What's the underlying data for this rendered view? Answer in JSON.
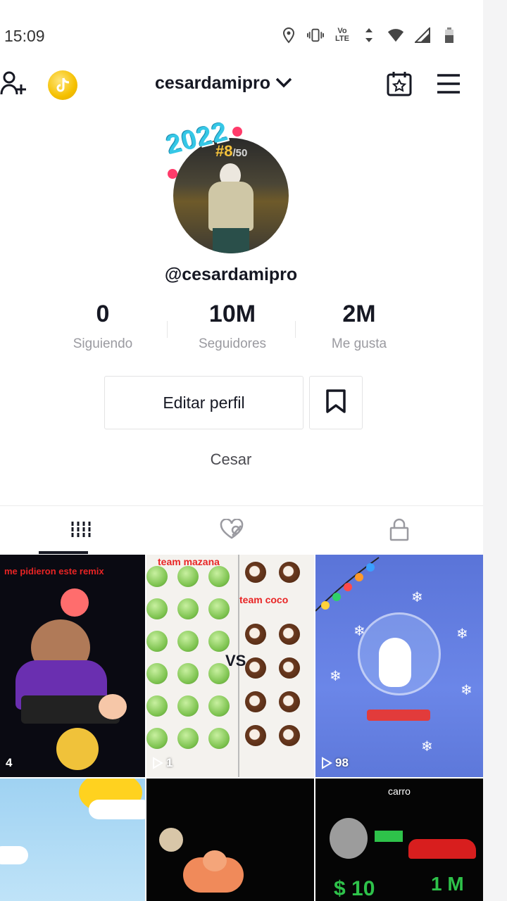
{
  "status_bar": {
    "time": "15:09",
    "network": "LTE"
  },
  "header": {
    "username": "cesardamipro"
  },
  "profile": {
    "handle": "@cesardamipro",
    "avatar_rank": "#8",
    "avatar_rank_total": "/50",
    "avatar_badge": "2022",
    "bio": "Cesar"
  },
  "stats": [
    {
      "value": "0",
      "label": "Siguiendo"
    },
    {
      "value": "10M",
      "label": "Seguidores"
    },
    {
      "value": "2M",
      "label": "Me gusta"
    }
  ],
  "actions": {
    "edit_profile": "Editar perfil"
  },
  "tabs": [
    {
      "name": "videos",
      "icon": "grid-icon",
      "active": true
    },
    {
      "name": "liked",
      "icon": "hidden-heart-icon",
      "active": false
    },
    {
      "name": "private",
      "icon": "lock-icon",
      "active": false
    }
  ],
  "videos": [
    {
      "caption": "me pidieron este remix",
      "views": "4"
    },
    {
      "caption_top": "team mazana",
      "caption_right": "team coco",
      "vs": "VS",
      "views": "1"
    },
    {
      "views": "98"
    },
    {},
    {},
    {
      "caption": "carro",
      "price_left": "$ 10",
      "price_right": "1 M"
    }
  ],
  "colors": {
    "accent": "#fe2c55",
    "text": "#161823",
    "muted": "#9a9aa0"
  }
}
